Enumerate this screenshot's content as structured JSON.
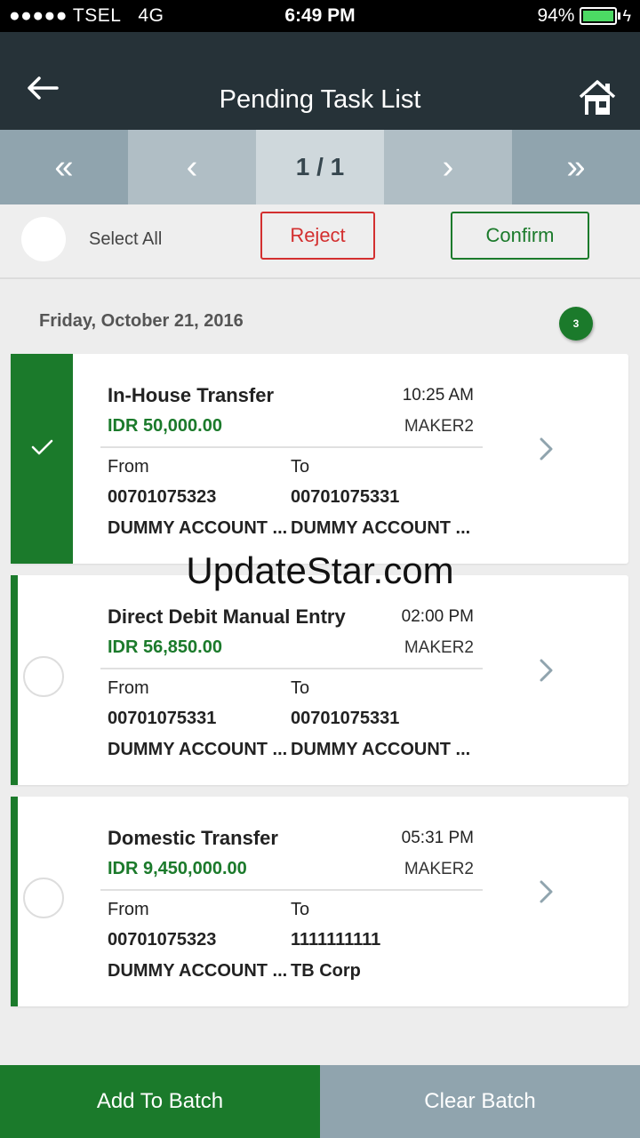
{
  "status_bar": {
    "carrier": "●●●●● TSEL",
    "network": "4G",
    "time": "6:49 PM",
    "battery": "94%"
  },
  "header": {
    "title": "Pending Task List"
  },
  "pager": {
    "page": "1 / 1",
    "first": "«",
    "prev": "‹",
    "next": "›",
    "last": "»"
  },
  "actions": {
    "select_all": "Select All",
    "reject": "Reject",
    "confirm": "Confirm"
  },
  "date_group": {
    "date": "Friday, October 21, 2016",
    "count": "3"
  },
  "tasks": [
    {
      "type": "In-House Transfer",
      "time": "10:25 AM",
      "amount": "IDR 50,000.00",
      "maker": "MAKER2",
      "from_label": "From",
      "to_label": "To",
      "from_account": "00701075323",
      "to_account": "00701075331",
      "from_name": "DUMMY ACCOUNT ...",
      "to_name": "DUMMY ACCOUNT ...",
      "selected": true
    },
    {
      "type": "Direct Debit Manual Entry",
      "time": "02:00 PM",
      "amount": "IDR 56,850.00",
      "maker": "MAKER2",
      "from_label": "From",
      "to_label": "To",
      "from_account": "00701075331",
      "to_account": "00701075331",
      "from_name": "DUMMY ACCOUNT ...",
      "to_name": "DUMMY ACCOUNT ...",
      "selected": false
    },
    {
      "type": "Domestic Transfer",
      "time": "05:31 PM",
      "amount": "IDR 9,450,000.00",
      "maker": "MAKER2",
      "from_label": "From",
      "to_label": "To",
      "from_account": "00701075323",
      "to_account": "1111111111",
      "from_name": "DUMMY ACCOUNT ...",
      "to_name": "TB Corp",
      "selected": false
    }
  ],
  "watermark": "UpdateStar.com",
  "bottom": {
    "add_batch": "Add To Batch",
    "clear_batch": "Clear Batch"
  },
  "colors": {
    "primary_green": "#1b7a2b",
    "reject_red": "#d32f2f",
    "header_dark": "#263238",
    "pager_gray": "#90a4ae"
  }
}
